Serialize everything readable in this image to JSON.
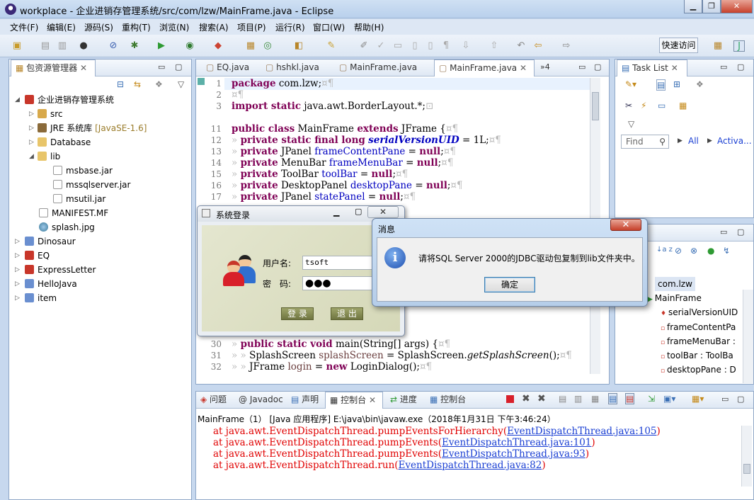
{
  "window": {
    "title": "workplace - 企业进销存管理系统/src/com/lzw/MainFrame.java - Eclipse"
  },
  "menu": [
    "文件(F)",
    "编辑(E)",
    "源码(S)",
    "重构(T)",
    "浏览(N)",
    "搜索(A)",
    "项目(P)",
    "运行(R)",
    "窗口(W)",
    "帮助(H)"
  ],
  "toolbar": {
    "quick_access": "快速访问"
  },
  "explorer": {
    "title": "包资源管理器",
    "items": [
      "企业进销存管理系统",
      "src",
      "JRE 系统库",
      "[JavaSE-1.6]",
      "Database",
      "lib",
      "msbase.jar",
      "mssqlserver.jar",
      "msutil.jar",
      "MANIFEST.MF",
      "splash.jpg",
      "Dinosaur",
      "EQ",
      "ExpressLetter",
      "HelloJava",
      "item"
    ]
  },
  "editor": {
    "tabs": [
      "EQ.java",
      "hshkl.java",
      "MainFrame.java",
      "MainFrame.java",
      "»4"
    ],
    "lines": {
      "n1": "1",
      "n2": "2",
      "n3": "3",
      "n11": "11",
      "n12": "12",
      "n13": "13",
      "n14": "14",
      "n15": "15",
      "n16": "16",
      "n17": "17",
      "n30": "30",
      "n31": "31",
      "n32": "32",
      "l1_kw": "package",
      "l1_rest": " com.lzw;",
      "l3_kw": "import static",
      "l3_rest": " java.awt.BorderLayout.*;",
      "l11_kw": "public class",
      "l11_mid": " MainFrame ",
      "l11_kw2": "extends",
      "l11_rest": " JFrame {",
      "l12_kw": "private static final long",
      "l12_fld": "serialVersionUID",
      "l12_rest": " = 1L;",
      "l13_kw": "private",
      "l13_type": " JPanel ",
      "l13_fld": "frameContentPane",
      "l13_eq": " = ",
      "l13_null": "null",
      "l13_end": ";",
      "l14_kw": "private",
      "l14_type": " MenuBar ",
      "l14_fld": "frameMenuBar",
      "l14_eq": " = ",
      "l14_null": "null",
      "l14_end": ";",
      "l15_kw": "private",
      "l15_type": " ToolBar ",
      "l15_fld": "toolBar",
      "l15_eq": " = ",
      "l15_null": "null",
      "l15_end": ";",
      "l16_kw": "private",
      "l16_type": " DesktopPanel ",
      "l16_fld": "desktopPane",
      "l16_eq": " = ",
      "l16_null": "null",
      "l16_end": ";",
      "l17_kw": "private",
      "l17_type": " JPanel ",
      "l17_fld": "statePanel",
      "l17_eq": " = ",
      "l17_null": "null",
      "l17_end": ";",
      "l30_kw": "public static void",
      "l30_rest": " main(String[] args) {",
      "l31_a": "SplashScreen ",
      "l31_fld": "splashScreen",
      "l31_b": " = SplashScreen.",
      "l31_it": "getSplashScreen",
      "l31_c": "();",
      "l32_a": "JFrame ",
      "l32_fld": "login",
      "l32_b": " = ",
      "l32_kw": "new",
      "l32_c": " LoginDialog();"
    }
  },
  "tasklist": {
    "title": "Task List",
    "find_placeholder": "Find",
    "all": "All",
    "activate": "Activa..."
  },
  "outline": {
    "items": [
      "com.lzw",
      "MainFrame",
      "serialVersionUID",
      "frameContentPa",
      "frameMenuBar :",
      "toolBar : ToolBa",
      "desktopPane : D"
    ]
  },
  "bottom": {
    "tabs": [
      "问题",
      "@ Javadoc",
      "声明",
      "控制台",
      "进度",
      "控制台"
    ],
    "header": "MainFrame（1） [Java 应用程序] E:\\java\\bin\\javaw.exe（2018年1月31日 下午3:46:24）",
    "lines": [
      {
        "text": "at java.awt.EventDispatchThread.pumpEventsForHierarchy(",
        "link": "EventDispatchThread.java:105",
        "end": ")"
      },
      {
        "text": "at java.awt.EventDispatchThread.pumpEvents(",
        "link": "EventDispatchThread.java:101",
        "end": ")"
      },
      {
        "text": "at java.awt.EventDispatchThread.pumpEvents(",
        "link": "EventDispatchThread.java:93",
        "end": ")"
      },
      {
        "text": "at java.awt.EventDispatchThread.run(",
        "link": "EventDispatchThread.java:82",
        "end": ")"
      }
    ]
  },
  "login": {
    "title": "系统登录",
    "user_label": "用户名:",
    "user_value": "tsoft",
    "pwd_label": "密　码:",
    "pwd_value": "●●●",
    "login_btn": "登 录",
    "exit_btn": "退 出"
  },
  "message": {
    "title": "消息",
    "text": "请将SQL Server 2000的JDBC驱动包复制到lib文件夹中。",
    "ok": "确定",
    "icon": "i"
  }
}
